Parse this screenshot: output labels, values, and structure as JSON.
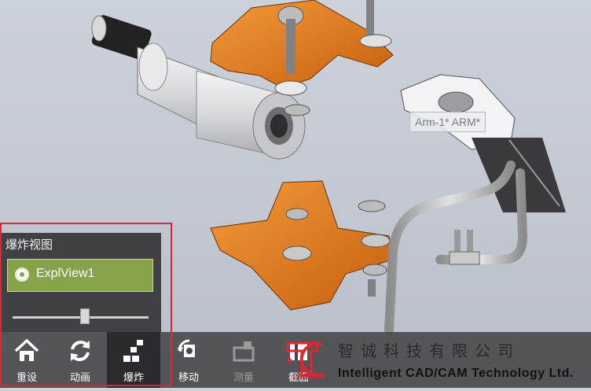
{
  "scene": {
    "tooltip": "Arm-1* ARM*"
  },
  "explode_panel": {
    "title": "爆炸视图",
    "view_name": "ExplView1",
    "slider_level": 0.53
  },
  "toolbar": {
    "buttons": [
      {
        "label": "重设",
        "icon": "home-icon"
      },
      {
        "label": "动画",
        "icon": "refresh-icon"
      },
      {
        "label": "爆炸",
        "icon": "explode-icon"
      },
      {
        "label": "移动",
        "icon": "move-icon"
      },
      {
        "label": "测量",
        "icon": "measure-icon"
      },
      {
        "label": "截面",
        "icon": "section-icon"
      }
    ]
  },
  "branding": {
    "logo_text": "CAD/CAM",
    "company_cn": "智诚科技有限公司",
    "company_en": "Intelligent CAD/CAM Technology Ltd."
  },
  "colors": {
    "accent_orange": "#e87a1e",
    "active_green": "#86a349",
    "highlight_red": "#e0262e"
  }
}
